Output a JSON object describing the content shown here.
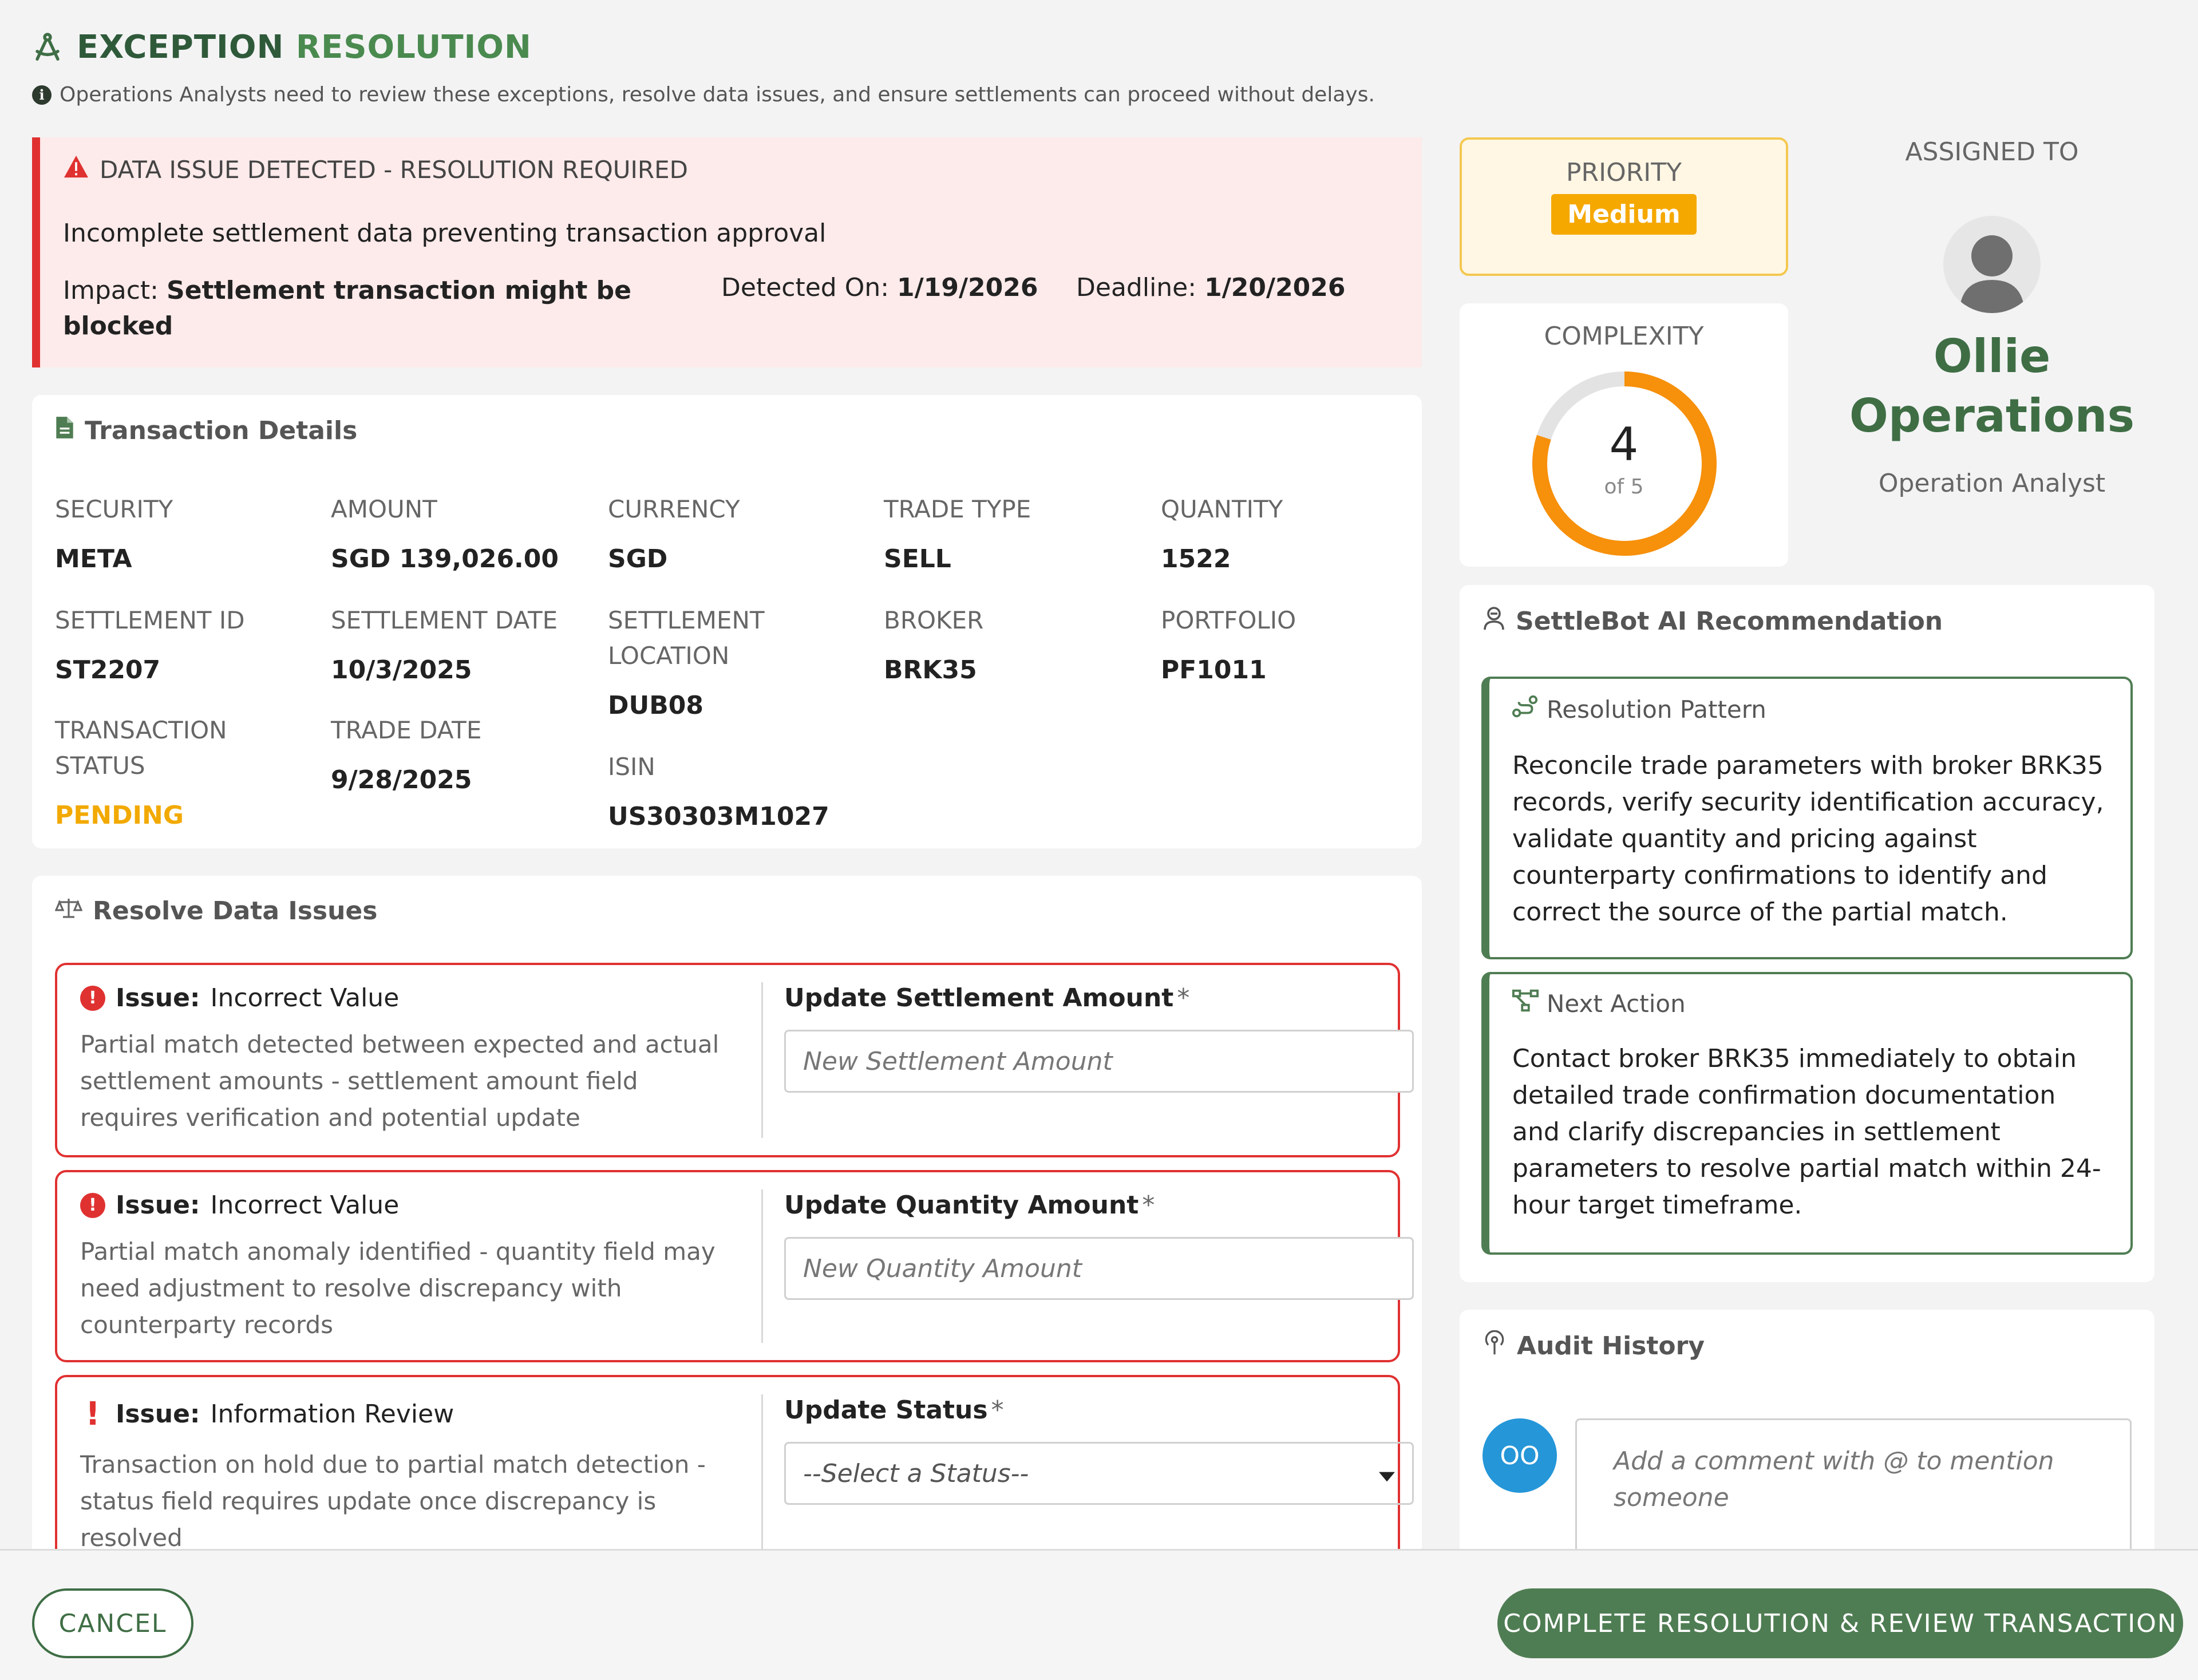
{
  "header": {
    "title_part1": "EXCEPTION",
    "title_part2": "RESOLUTION",
    "subtitle": "Operations Analysts need to review these exceptions, resolve data issues, and ensure settlements can proceed without delays."
  },
  "alert": {
    "heading": "DATA ISSUE DETECTED - RESOLUTION REQUIRED",
    "description": "Incomplete settlement data preventing transaction approval",
    "impact_label": "Impact:",
    "impact_value": "Settlement transaction might be blocked",
    "detected_label": "Detected On:",
    "detected_value": "1/19/2026",
    "deadline_label": "Deadline:",
    "deadline_value": "1/20/2026"
  },
  "transaction": {
    "title": "Transaction Details",
    "fields": [
      {
        "label": "SECURITY",
        "value": "META"
      },
      {
        "label": "AMOUNT",
        "value": "SGD 139,026.00"
      },
      {
        "label": "CURRENCY",
        "value": "SGD"
      },
      {
        "label": "TRADE TYPE",
        "value": "SELL"
      },
      {
        "label": "QUANTITY",
        "value": "1522"
      },
      {
        "label": "SETTLEMENT ID",
        "value": "ST2207"
      },
      {
        "label": "SETTLEMENT DATE",
        "value": "10/3/2025"
      },
      {
        "label": "SETTLEMENT LOCATION",
        "value": "DUB08"
      },
      {
        "label": "BROKER",
        "value": "BRK35"
      },
      {
        "label": "PORTFOLIO",
        "value": "PF1011"
      },
      {
        "label": "TRANSACTION STATUS",
        "value": "PENDING"
      },
      {
        "label": "TRADE DATE",
        "value": "9/28/2025"
      },
      {
        "label": "ISIN",
        "value": "US30303M1027"
      }
    ]
  },
  "resolve": {
    "title": "Resolve Data Issues",
    "issue_label": "Issue:",
    "issues": [
      {
        "type": "Incorrect Value",
        "description": "Partial match detected between expected and actual settlement amounts - settlement amount field requires verification and potential update",
        "field_label": "Update Settlement Amount",
        "required_mark": "*",
        "placeholder": "New Settlement Amount"
      },
      {
        "type": "Incorrect Value",
        "description": "Partial match anomaly identified - quantity field may need adjustment to resolve discrepancy with counterparty records",
        "field_label": "Update Quantity Amount",
        "required_mark": "*",
        "placeholder": "New Quantity Amount"
      },
      {
        "type": "Information Review",
        "description": "Transaction on hold due to partial match detection - status field requires update once discrepancy is resolved",
        "field_label": "Update Status",
        "required_mark": "*",
        "select_value": "--Select a Status--"
      }
    ]
  },
  "priority": {
    "label": "PRIORITY",
    "value": "Medium",
    "color": "#f5a800"
  },
  "complexity": {
    "label": "COMPLEXITY",
    "value": 4,
    "max": 5,
    "value_text": "4",
    "of_text": "of 5",
    "color": "#f7900a"
  },
  "assigned": {
    "label": "ASSIGNED TO",
    "name_line1": "Ollie",
    "name_line2": "Operations",
    "role": "Operation Analyst"
  },
  "settlebot": {
    "title": "SettleBot AI Recommendation",
    "pattern_title": "Resolution Pattern",
    "pattern_body": "Reconcile trade parameters with broker BRK35 records, verify security identification accuracy, validate quantity and pricing against counterparty confirmations to identify and correct the source of the partial match.",
    "action_title": "Next Action",
    "action_body": "Contact broker BRK35 immediately to obtain detailed trade confirmation documentation and clarify discrepancies in settlement parameters to resolve partial match within 24-hour target timeframe."
  },
  "audit": {
    "title": "Audit History",
    "avatar_initials": "OO",
    "comment_placeholder": "Add a comment with @ to mention someone"
  },
  "footer": {
    "cancel_label": "CANCEL",
    "complete_label": "COMPLETE RESOLUTION & REVIEW TRANSACTION"
  },
  "colors": {
    "brand_green": "#4f7d53",
    "error_red": "#e03131",
    "warning_amber": "#f5a800"
  }
}
